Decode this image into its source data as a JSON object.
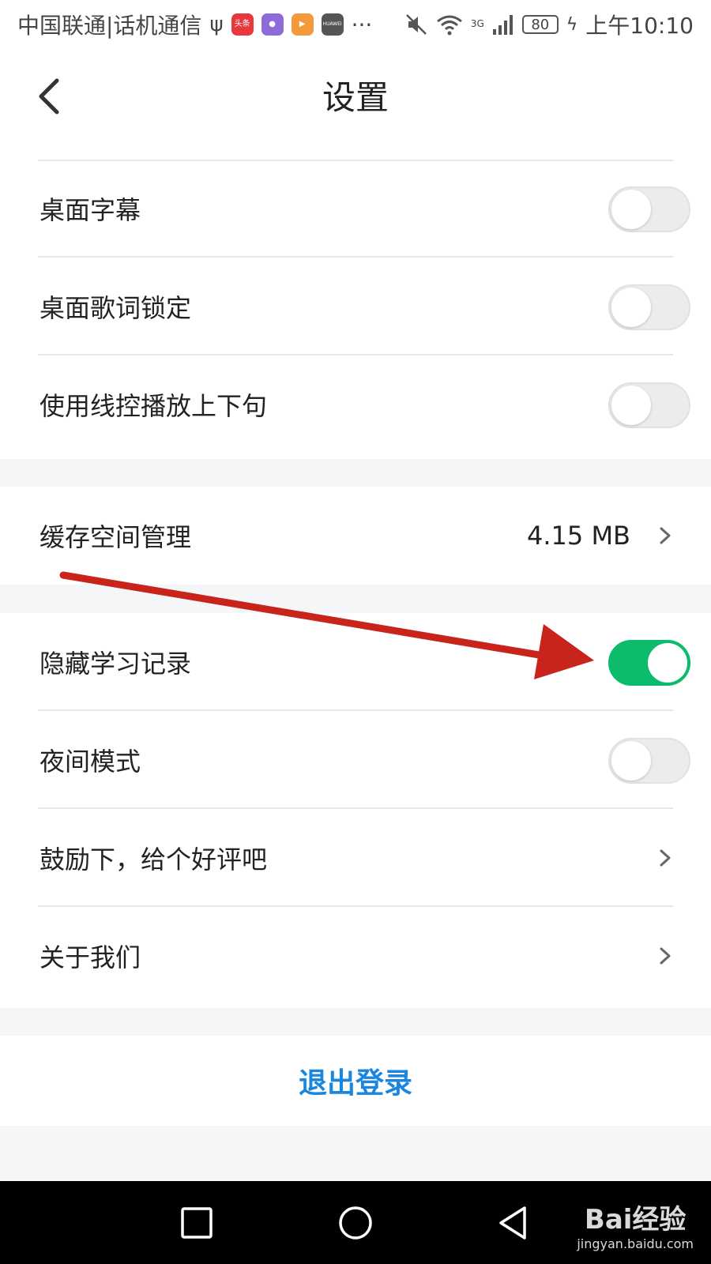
{
  "status_bar": {
    "carrier": "中国联通|话机通信",
    "app_icon_toutiao": "头条",
    "app_icon_huawei": "HUAWEI",
    "more": "···",
    "network": "3G",
    "battery": "80",
    "time": "上午10:10"
  },
  "header": {
    "title": "设置",
    "back_icon": "chevron-left-icon"
  },
  "settings": {
    "group1": [
      {
        "label": "桌面字幕",
        "toggle_on": false
      },
      {
        "label": "桌面歌词锁定",
        "toggle_on": false
      },
      {
        "label": "使用线控播放上下句",
        "toggle_on": false
      }
    ],
    "cache": {
      "label": "缓存空间管理",
      "value": "4.15 MB"
    },
    "group3": {
      "hide_history": {
        "label": "隐藏学习记录",
        "toggle_on": true
      },
      "night_mode": {
        "label": "夜间模式",
        "toggle_on": false
      },
      "rate_us": {
        "label": "鼓励下，给个好评吧"
      },
      "about": {
        "label": "关于我们"
      }
    },
    "logout": "退出登录"
  },
  "nav_bar": {
    "icons": [
      "square-icon",
      "circle-icon",
      "triangle-back-icon"
    ]
  },
  "watermark": {
    "brand": "Bai经验",
    "url": "jingyan.baidu.com"
  },
  "colors": {
    "toggle_on": "#0cbb6b",
    "logout": "#1a86e0",
    "annotation_arrow": "#c8241c"
  }
}
